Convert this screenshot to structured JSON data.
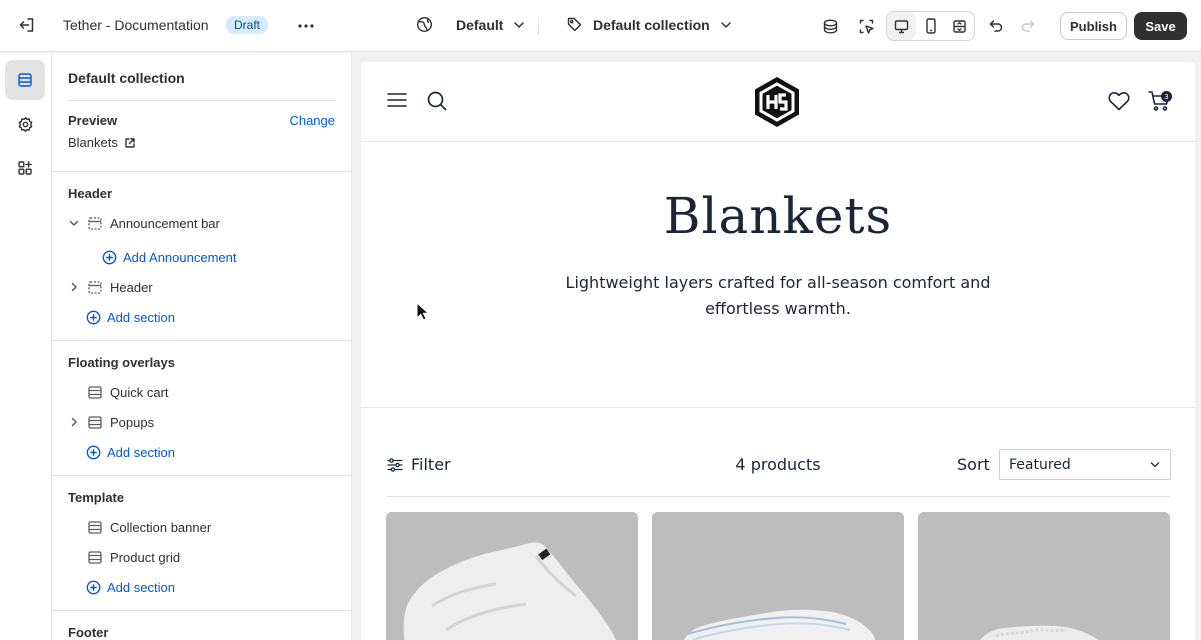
{
  "topbar": {
    "theme_title": "Tether - Documentation",
    "status_badge": "Draft",
    "locale_selector": "Default",
    "template_selector": "Default collection",
    "publish_label": "Publish",
    "save_label": "Save"
  },
  "sidebar": {
    "title": "Default collection",
    "preview": {
      "label": "Preview",
      "change_label": "Change",
      "value": "Blankets"
    },
    "groups": [
      {
        "title": "Header",
        "items": [
          {
            "label": "Announcement bar",
            "expanded": true,
            "child_add": "Add Announcement"
          },
          {
            "label": "Header",
            "expanded": false
          }
        ],
        "add_label": "Add section"
      },
      {
        "title": "Floating overlays",
        "items": [
          {
            "label": "Quick cart"
          },
          {
            "label": "Popups",
            "expanded": false
          }
        ],
        "add_label": "Add section"
      },
      {
        "title": "Template",
        "items": [
          {
            "label": "Collection banner"
          },
          {
            "label": "Product grid"
          }
        ],
        "add_label": "Add section"
      },
      {
        "title": "Footer"
      }
    ]
  },
  "store": {
    "cart_count": "3",
    "hero_title": "Blankets",
    "hero_subtitle": "Lightweight layers crafted for all-season comfort and effortless warmth.",
    "filter_label": "Filter",
    "product_count": "4 products",
    "sort_label": "Sort",
    "sort_value": "Featured"
  },
  "colors": {
    "accent_blue": "#005bd3",
    "draft_badge_bg": "#d5ebff",
    "save_button_bg": "#303030",
    "hero_text": "#1b2537"
  }
}
